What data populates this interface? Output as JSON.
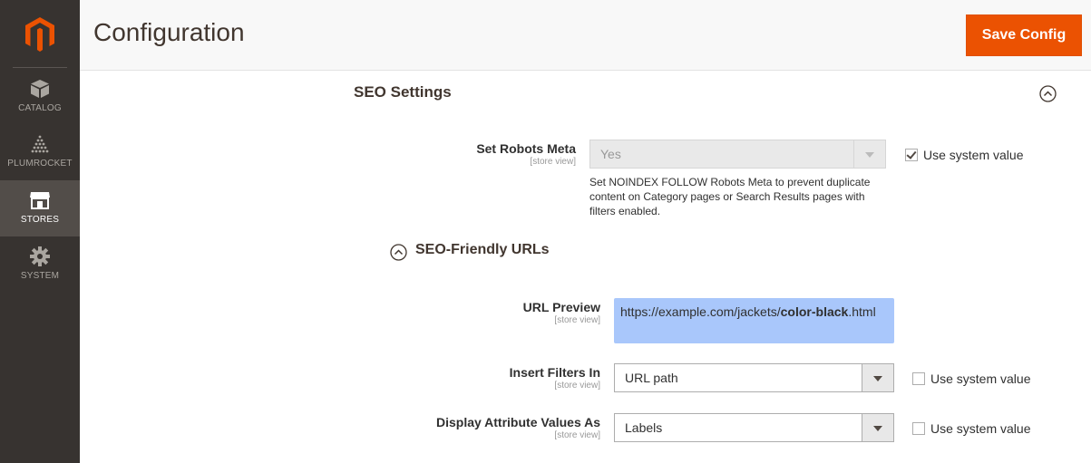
{
  "header": {
    "title": "Configuration",
    "save_label": "Save Config"
  },
  "sidebar": {
    "items": [
      {
        "label": "CATALOG",
        "icon": "box-icon"
      },
      {
        "label": "PLUMROCKET",
        "icon": "plumrocket-icon"
      },
      {
        "label": "STORES",
        "icon": "store-icon",
        "active": true
      },
      {
        "label": "SYSTEM",
        "icon": "gear-icon"
      }
    ]
  },
  "seo": {
    "title": "SEO Settings",
    "robots": {
      "label": "Set Robots Meta",
      "scope": "[store view]",
      "value": "Yes",
      "use_system": "Use system value",
      "use_system_checked": true,
      "note": "Set NOINDEX FOLLOW Robots Meta to prevent duplicate content on Category pages or Search Results pages with filters enabled."
    },
    "friendly": {
      "title": "SEO-Friendly URLs",
      "url_preview": {
        "label": "URL Preview",
        "scope": "[store view]",
        "prefix": "https://example.com/jackets/",
        "bold": "color-black",
        "suffix": ".html"
      },
      "insert_filters": {
        "label": "Insert Filters In",
        "scope": "[store view]",
        "value": "URL path",
        "use_system": "Use system value",
        "use_system_checked": false
      },
      "display_values": {
        "label": "Display Attribute Values As",
        "scope": "[store view]",
        "value": "Labels",
        "use_system": "Use system value",
        "use_system_checked": false
      }
    }
  },
  "colors": {
    "accent": "#eb5202",
    "sidebar": "#373330",
    "highlight": "#a9c7fb"
  }
}
